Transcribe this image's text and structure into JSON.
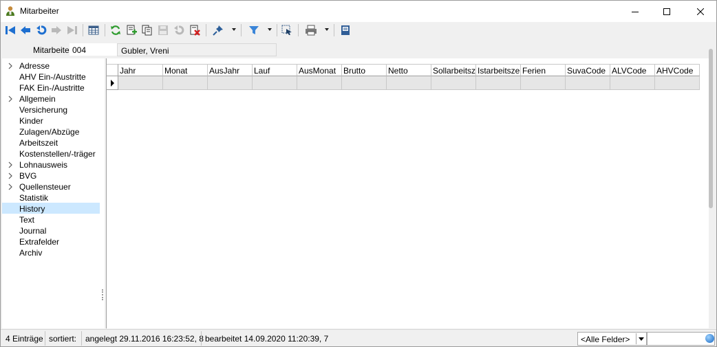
{
  "window": {
    "title": "Mitarbeiter",
    "app_icon": "person-icon",
    "controls": [
      "minimize-icon",
      "maximize-icon",
      "close-icon"
    ]
  },
  "toolbar": {
    "icons": [
      "first-record-icon",
      "previous-record-icon",
      "undo-icon",
      "next-record-icon",
      "last-record-icon",
      "table-view-icon",
      "refresh-icon",
      "new-record-icon",
      "copy-record-icon",
      "save-icon",
      "undo-changes-icon",
      "delete-icon",
      "pin-icon",
      "filter-icon",
      "cursor-select-icon",
      "print-icon",
      "notes-icon"
    ]
  },
  "header": {
    "label": "Mitarbeiter",
    "code": "004",
    "name": "Gubler, Vreni"
  },
  "nav": {
    "items": [
      {
        "label": "Adresse",
        "expandable": true,
        "selected": false
      },
      {
        "label": "AHV Ein-/Austritte",
        "expandable": false,
        "selected": false
      },
      {
        "label": "FAK Ein-/Austritte",
        "expandable": false,
        "selected": false
      },
      {
        "label": "Allgemein",
        "expandable": true,
        "selected": false
      },
      {
        "label": "Versicherung",
        "expandable": false,
        "selected": false
      },
      {
        "label": "Kinder",
        "expandable": false,
        "selected": false
      },
      {
        "label": "Zulagen/Abzüge",
        "expandable": false,
        "selected": false
      },
      {
        "label": "Arbeitszeit",
        "expandable": false,
        "selected": false
      },
      {
        "label": "Kostenstellen/-träger",
        "expandable": false,
        "selected": false
      },
      {
        "label": "Lohnausweis",
        "expandable": true,
        "selected": false
      },
      {
        "label": "BVG",
        "expandable": true,
        "selected": false
      },
      {
        "label": "Quellensteuer",
        "expandable": true,
        "selected": false
      },
      {
        "label": "Statistik",
        "expandable": false,
        "selected": false
      },
      {
        "label": "History",
        "expandable": false,
        "selected": true
      },
      {
        "label": "Text",
        "expandable": false,
        "selected": false
      },
      {
        "label": "Journal",
        "expandable": false,
        "selected": false
      },
      {
        "label": "Extrafelder",
        "expandable": false,
        "selected": false
      },
      {
        "label": "Archiv",
        "expandable": false,
        "selected": false
      }
    ]
  },
  "grid": {
    "columns": [
      "Jahr",
      "Monat",
      "AusJahr",
      "Lauf",
      "AusMonat",
      "Brutto",
      "Netto",
      "Sollarbeitszeit",
      "Istarbeitszeit",
      "Ferien",
      "SuvaCode",
      "ALVCode",
      "AHVCode"
    ],
    "rows": [
      [
        "",
        "",
        "",
        "",
        "",
        "",
        "",
        "",
        "",
        "",
        "",
        "",
        ""
      ]
    ]
  },
  "status": {
    "count": "4 Einträge",
    "sorted": "sortiert:",
    "created": "angelegt 29.11.2016 16:23:52,  8",
    "edited": "bearbeitet 14.09.2020 11:20:39,  7",
    "filter_value": "<Alle Felder>",
    "search_value": ""
  }
}
